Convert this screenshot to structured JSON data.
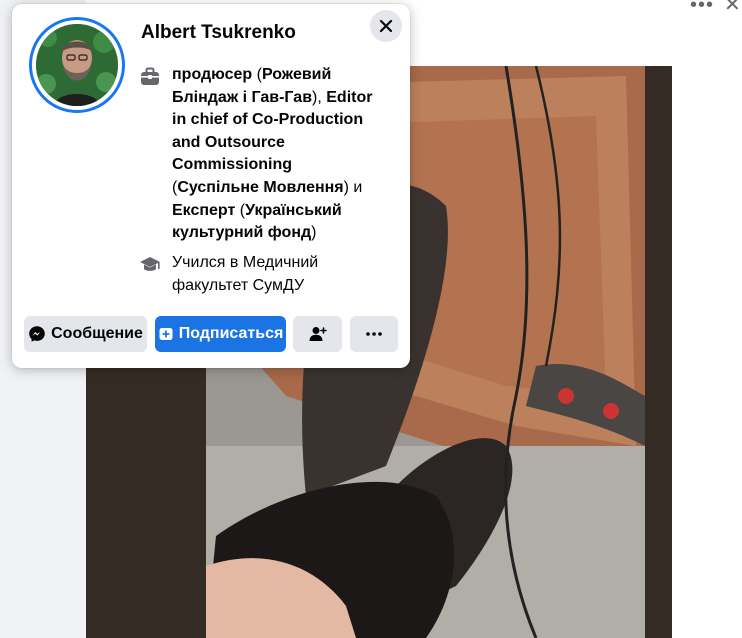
{
  "post": {
    "menu_icon": "more-horizontal-icon",
    "close_icon": "close-icon"
  },
  "hover_card": {
    "name": "Albert Tsukrenko",
    "work": {
      "icon": "briefcase-icon",
      "parts": [
        {
          "text": "продюсер",
          "bold": true
        },
        {
          "text": " (",
          "bold": false
        },
        {
          "text": "Рожевий Бліндаж і Гав-Гав",
          "bold": true
        },
        {
          "text": "), ",
          "bold": false
        },
        {
          "text": "Editor in chief of Co-Production and Outsource Commissioning",
          "bold": true
        },
        {
          "text": " (",
          "bold": false
        },
        {
          "text": "Суспільне Мовлення",
          "bold": true
        },
        {
          "text": ") и ",
          "bold": false
        },
        {
          "text": "Експерт",
          "bold": true
        },
        {
          "text": " (",
          "bold": false
        },
        {
          "text": "Український культурний фонд",
          "bold": true
        },
        {
          "text": ")",
          "bold": false
        }
      ]
    },
    "education": {
      "icon": "graduation-cap-icon",
      "prefix": "Учился в ",
      "school": "Медичний факультет СумДУ"
    },
    "buttons": {
      "message": "Сообщение",
      "follow": "Подписаться",
      "add_friend_icon": "add-friend-icon",
      "more_icon": "more-horizontal-icon"
    },
    "colors": {
      "accent": "#1b74e4",
      "avatar_ring": "#1877f2",
      "button_gray": "#e4e6eb"
    }
  }
}
